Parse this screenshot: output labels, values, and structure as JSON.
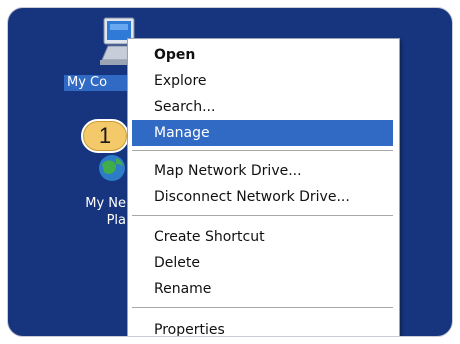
{
  "desktop": {
    "background_color": "#17357f",
    "icons": [
      {
        "label": "My Co",
        "icon": "my-computer-icon",
        "selected": true
      },
      {
        "label_line1": "My Ne",
        "label_line2": "Pla",
        "icon": "my-network-places-icon"
      }
    ]
  },
  "step_badge": {
    "number": "1"
  },
  "context_menu": {
    "items": [
      {
        "label": "Open",
        "bold": true
      },
      {
        "label": "Explore"
      },
      {
        "label": "Search..."
      },
      {
        "label": "Manage",
        "selected": true
      },
      {
        "label": "Map Network Drive..."
      },
      {
        "label": "Disconnect Network Drive..."
      },
      {
        "label": "Create Shortcut"
      },
      {
        "label": "Delete"
      },
      {
        "label": "Rename"
      },
      {
        "label": "Properties"
      }
    ],
    "highlight_color": "#316ac5"
  }
}
